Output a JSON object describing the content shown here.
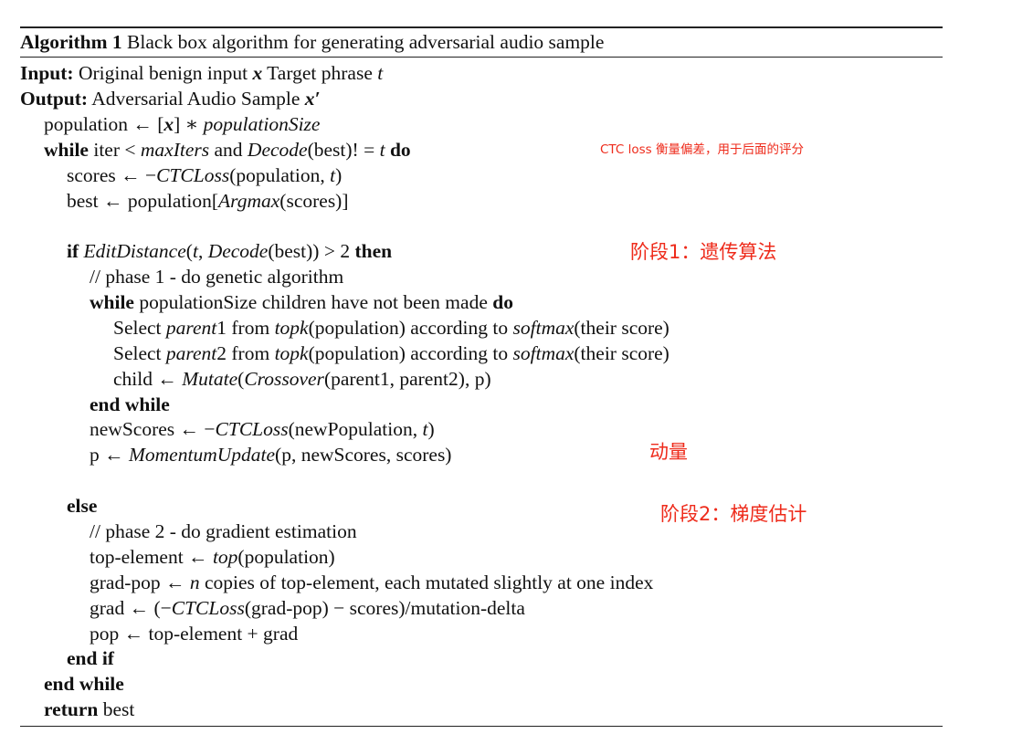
{
  "algorithm": {
    "caption_label": "Algorithm 1",
    "caption_text": "Black box algorithm for generating adversarial audio sample",
    "lines": [
      {
        "indent": 0,
        "parts": [
          {
            "t": "Input:",
            "s": "b"
          },
          {
            "t": " Original benign input "
          },
          {
            "t": "x",
            "s": "bi"
          },
          {
            "t": " Target phrase "
          },
          {
            "t": "t",
            "s": "i"
          }
        ]
      },
      {
        "indent": 0,
        "parts": [
          {
            "t": "Output:",
            "s": "b"
          },
          {
            "t": " Adversarial Audio Sample "
          },
          {
            "t": "x′",
            "s": "bi"
          }
        ]
      },
      {
        "indent": 1,
        "parts": [
          {
            "t": "population ← ["
          },
          {
            "t": "x",
            "s": "bi"
          },
          {
            "t": "] ∗ "
          },
          {
            "t": "populationSize",
            "s": "i"
          }
        ]
      },
      {
        "indent": 1,
        "parts": [
          {
            "t": "while",
            "s": "b"
          },
          {
            "t": " iter < "
          },
          {
            "t": "maxIters",
            "s": "i"
          },
          {
            "t": " and "
          },
          {
            "t": "Decode",
            "s": "i"
          },
          {
            "t": "(best)! = "
          },
          {
            "t": "t",
            "s": "i"
          },
          {
            "t": " "
          },
          {
            "t": "do",
            "s": "b"
          }
        ]
      },
      {
        "indent": 2,
        "parts": [
          {
            "t": "scores ← −"
          },
          {
            "t": "CTCLoss",
            "s": "i"
          },
          {
            "t": "(population, "
          },
          {
            "t": "t",
            "s": "i"
          },
          {
            "t": ")"
          }
        ]
      },
      {
        "indent": 2,
        "parts": [
          {
            "t": "best ← population["
          },
          {
            "t": "Argmax",
            "s": "i"
          },
          {
            "t": "(scores)]"
          }
        ]
      },
      {
        "indent": 2,
        "parts": [
          {
            "t": "if",
            "s": "b"
          },
          {
            "t": " "
          },
          {
            "t": "EditDistance",
            "s": "i"
          },
          {
            "t": "("
          },
          {
            "t": "t",
            "s": "i"
          },
          {
            "t": ", "
          },
          {
            "t": "Decode",
            "s": "i"
          },
          {
            "t": "(best)) > 2 "
          },
          {
            "t": "then",
            "s": "b"
          }
        ]
      },
      {
        "indent": 3,
        "parts": [
          {
            "t": "// phase 1 - do genetic algorithm"
          }
        ]
      },
      {
        "indent": 3,
        "parts": [
          {
            "t": "while",
            "s": "b"
          },
          {
            "t": " populationSize children have not been made "
          },
          {
            "t": "do",
            "s": "b"
          }
        ]
      },
      {
        "indent": 4,
        "parts": [
          {
            "t": "Select "
          },
          {
            "t": "parent",
            "s": "i"
          },
          {
            "t": "1 from "
          },
          {
            "t": "topk",
            "s": "i"
          },
          {
            "t": "(population) according to "
          },
          {
            "t": "softmax",
            "s": "i"
          },
          {
            "t": "(their score)"
          }
        ]
      },
      {
        "indent": 4,
        "parts": [
          {
            "t": "Select "
          },
          {
            "t": "parent",
            "s": "i"
          },
          {
            "t": "2 from "
          },
          {
            "t": "topk",
            "s": "i"
          },
          {
            "t": "(population) according to "
          },
          {
            "t": "softmax",
            "s": "i"
          },
          {
            "t": "(their score)"
          }
        ]
      },
      {
        "indent": 4,
        "parts": [
          {
            "t": "child ← "
          },
          {
            "t": "Mutate",
            "s": "i"
          },
          {
            "t": "("
          },
          {
            "t": "Crossover",
            "s": "i"
          },
          {
            "t": "(parent1, parent2), p)"
          }
        ]
      },
      {
        "indent": 3,
        "parts": [
          {
            "t": "end while",
            "s": "b"
          }
        ]
      },
      {
        "indent": 3,
        "parts": [
          {
            "t": "newScores ← −"
          },
          {
            "t": "CTCLoss",
            "s": "i"
          },
          {
            "t": "(newPopulation, "
          },
          {
            "t": "t",
            "s": "i"
          },
          {
            "t": ")"
          }
        ]
      },
      {
        "indent": 3,
        "parts": [
          {
            "t": "p ← "
          },
          {
            "t": "MomentumUpdate",
            "s": "i"
          },
          {
            "t": "(p, newScores, scores)"
          }
        ]
      },
      {
        "indent": 2,
        "parts": [
          {
            "t": "else",
            "s": "b"
          }
        ]
      },
      {
        "indent": 3,
        "parts": [
          {
            "t": "// phase 2 - do gradient estimation"
          }
        ]
      },
      {
        "indent": 3,
        "parts": [
          {
            "t": "top-element ← "
          },
          {
            "t": "top",
            "s": "i"
          },
          {
            "t": "(population)"
          }
        ]
      },
      {
        "indent": 3,
        "parts": [
          {
            "t": "grad-pop ← "
          },
          {
            "t": "n",
            "s": "i"
          },
          {
            "t": " copies of top-element, each mutated slightly at one index"
          }
        ]
      },
      {
        "indent": 3,
        "parts": [
          {
            "t": "grad ← (−"
          },
          {
            "t": "CTCLoss",
            "s": "i"
          },
          {
            "t": "(grad-pop) − scores)/mutation-delta"
          }
        ]
      },
      {
        "indent": 3,
        "parts": [
          {
            "t": "pop ← top-element + grad"
          }
        ]
      },
      {
        "indent": 2,
        "parts": [
          {
            "t": "end if",
            "s": "b"
          }
        ]
      },
      {
        "indent": 1,
        "parts": [
          {
            "t": "end while",
            "s": "b"
          }
        ]
      },
      {
        "indent": 1,
        "parts": [
          {
            "t": "return",
            "s": "b"
          },
          {
            "t": "  best"
          }
        ]
      }
    ]
  },
  "annotations": {
    "ctc_note": "CTC loss 衡量偏差，用于后面的评分",
    "phase1_note": "阶段1：遗传算法",
    "momentum_note": "动量",
    "phase2_note": "阶段2：梯度估计"
  }
}
